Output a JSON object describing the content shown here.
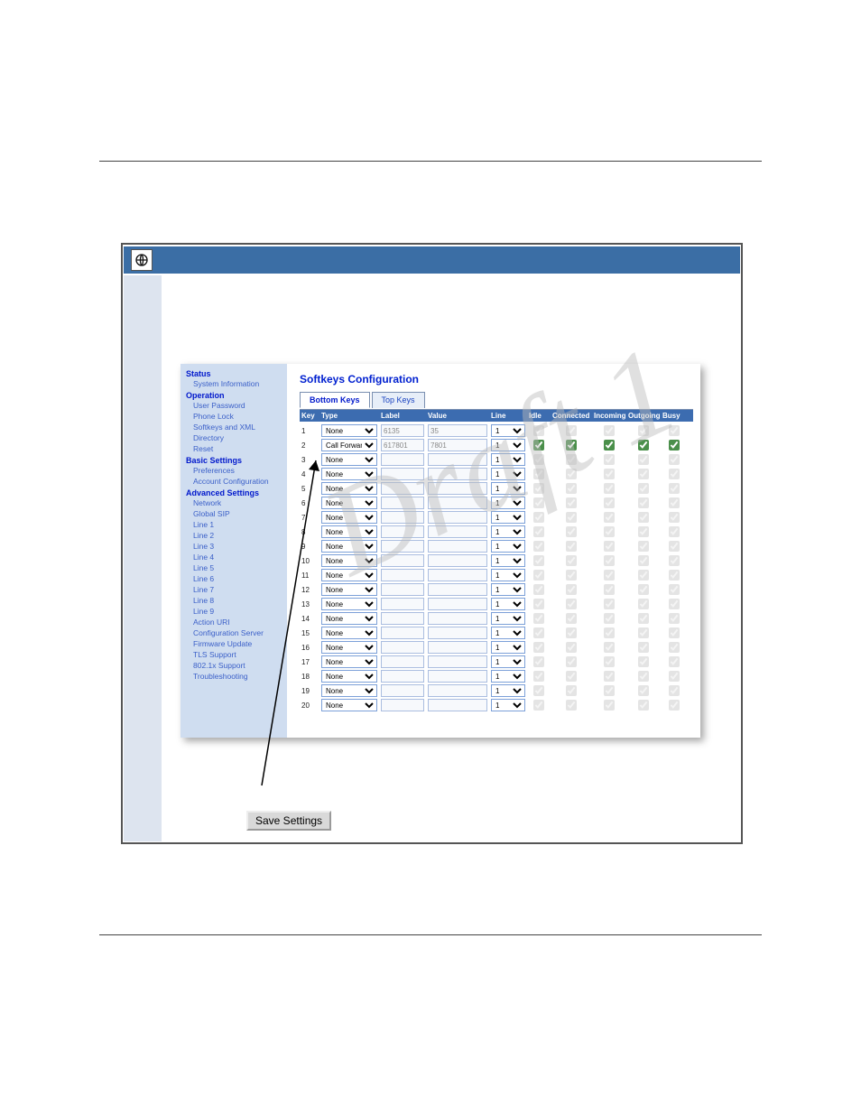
{
  "watermark": "Draft 1",
  "save_button": "Save Settings",
  "nav": {
    "groups": [
      {
        "heading": "Status",
        "items": [
          "System Information"
        ]
      },
      {
        "heading": "Operation",
        "items": [
          "User Password",
          "Phone Lock",
          "Softkeys and XML",
          "Directory",
          "Reset"
        ]
      },
      {
        "heading": "Basic Settings",
        "items": [
          "Preferences",
          "Account Configuration"
        ]
      },
      {
        "heading": "Advanced Settings",
        "items": [
          "Network",
          "Global SIP",
          "Line 1",
          "Line 2",
          "Line 3",
          "Line 4",
          "Line 5",
          "Line 6",
          "Line 7",
          "Line 8",
          "Line 9",
          "Action URI",
          "Configuration Server",
          "Firmware Update",
          "TLS Support",
          "802.1x Support",
          "Troubleshooting"
        ]
      }
    ]
  },
  "main": {
    "title": "Softkeys Configuration",
    "tabs": [
      {
        "label": "Bottom Keys",
        "active": true
      },
      {
        "label": "Top Keys",
        "active": false
      }
    ],
    "columns": [
      "Key",
      "Type",
      "Label",
      "Value",
      "Line",
      "Idle",
      "Connected",
      "Incoming",
      "Outgoing",
      "Busy"
    ],
    "rows": [
      {
        "key": 1,
        "type": "None",
        "label": "6135",
        "value": "35",
        "line": "1",
        "enabled": false
      },
      {
        "key": 2,
        "type": "Call Forward",
        "label": "617801",
        "value": "7801",
        "line": "1",
        "enabled": true
      },
      {
        "key": 3,
        "type": "None",
        "label": "",
        "value": "",
        "line": "1",
        "enabled": false
      },
      {
        "key": 4,
        "type": "None",
        "label": "",
        "value": "",
        "line": "1",
        "enabled": false
      },
      {
        "key": 5,
        "type": "None",
        "label": "",
        "value": "",
        "line": "1",
        "enabled": false
      },
      {
        "key": 6,
        "type": "None",
        "label": "",
        "value": "",
        "line": "1",
        "enabled": false
      },
      {
        "key": 7,
        "type": "None",
        "label": "",
        "value": "",
        "line": "1",
        "enabled": false
      },
      {
        "key": 8,
        "type": "None",
        "label": "",
        "value": "",
        "line": "1",
        "enabled": false
      },
      {
        "key": 9,
        "type": "None",
        "label": "",
        "value": "",
        "line": "1",
        "enabled": false
      },
      {
        "key": 10,
        "type": "None",
        "label": "",
        "value": "",
        "line": "1",
        "enabled": false
      },
      {
        "key": 11,
        "type": "None",
        "label": "",
        "value": "",
        "line": "1",
        "enabled": false
      },
      {
        "key": 12,
        "type": "None",
        "label": "",
        "value": "",
        "line": "1",
        "enabled": false
      },
      {
        "key": 13,
        "type": "None",
        "label": "",
        "value": "",
        "line": "1",
        "enabled": false
      },
      {
        "key": 14,
        "type": "None",
        "label": "",
        "value": "",
        "line": "1",
        "enabled": false
      },
      {
        "key": 15,
        "type": "None",
        "label": "",
        "value": "",
        "line": "1",
        "enabled": false
      },
      {
        "key": 16,
        "type": "None",
        "label": "",
        "value": "",
        "line": "1",
        "enabled": false
      },
      {
        "key": 17,
        "type": "None",
        "label": "",
        "value": "",
        "line": "1",
        "enabled": false
      },
      {
        "key": 18,
        "type": "None",
        "label": "",
        "value": "",
        "line": "1",
        "enabled": false
      },
      {
        "key": 19,
        "type": "None",
        "label": "",
        "value": "",
        "line": "1",
        "enabled": false
      },
      {
        "key": 20,
        "type": "None",
        "label": "",
        "value": "",
        "line": "1",
        "enabled": false
      }
    ]
  }
}
